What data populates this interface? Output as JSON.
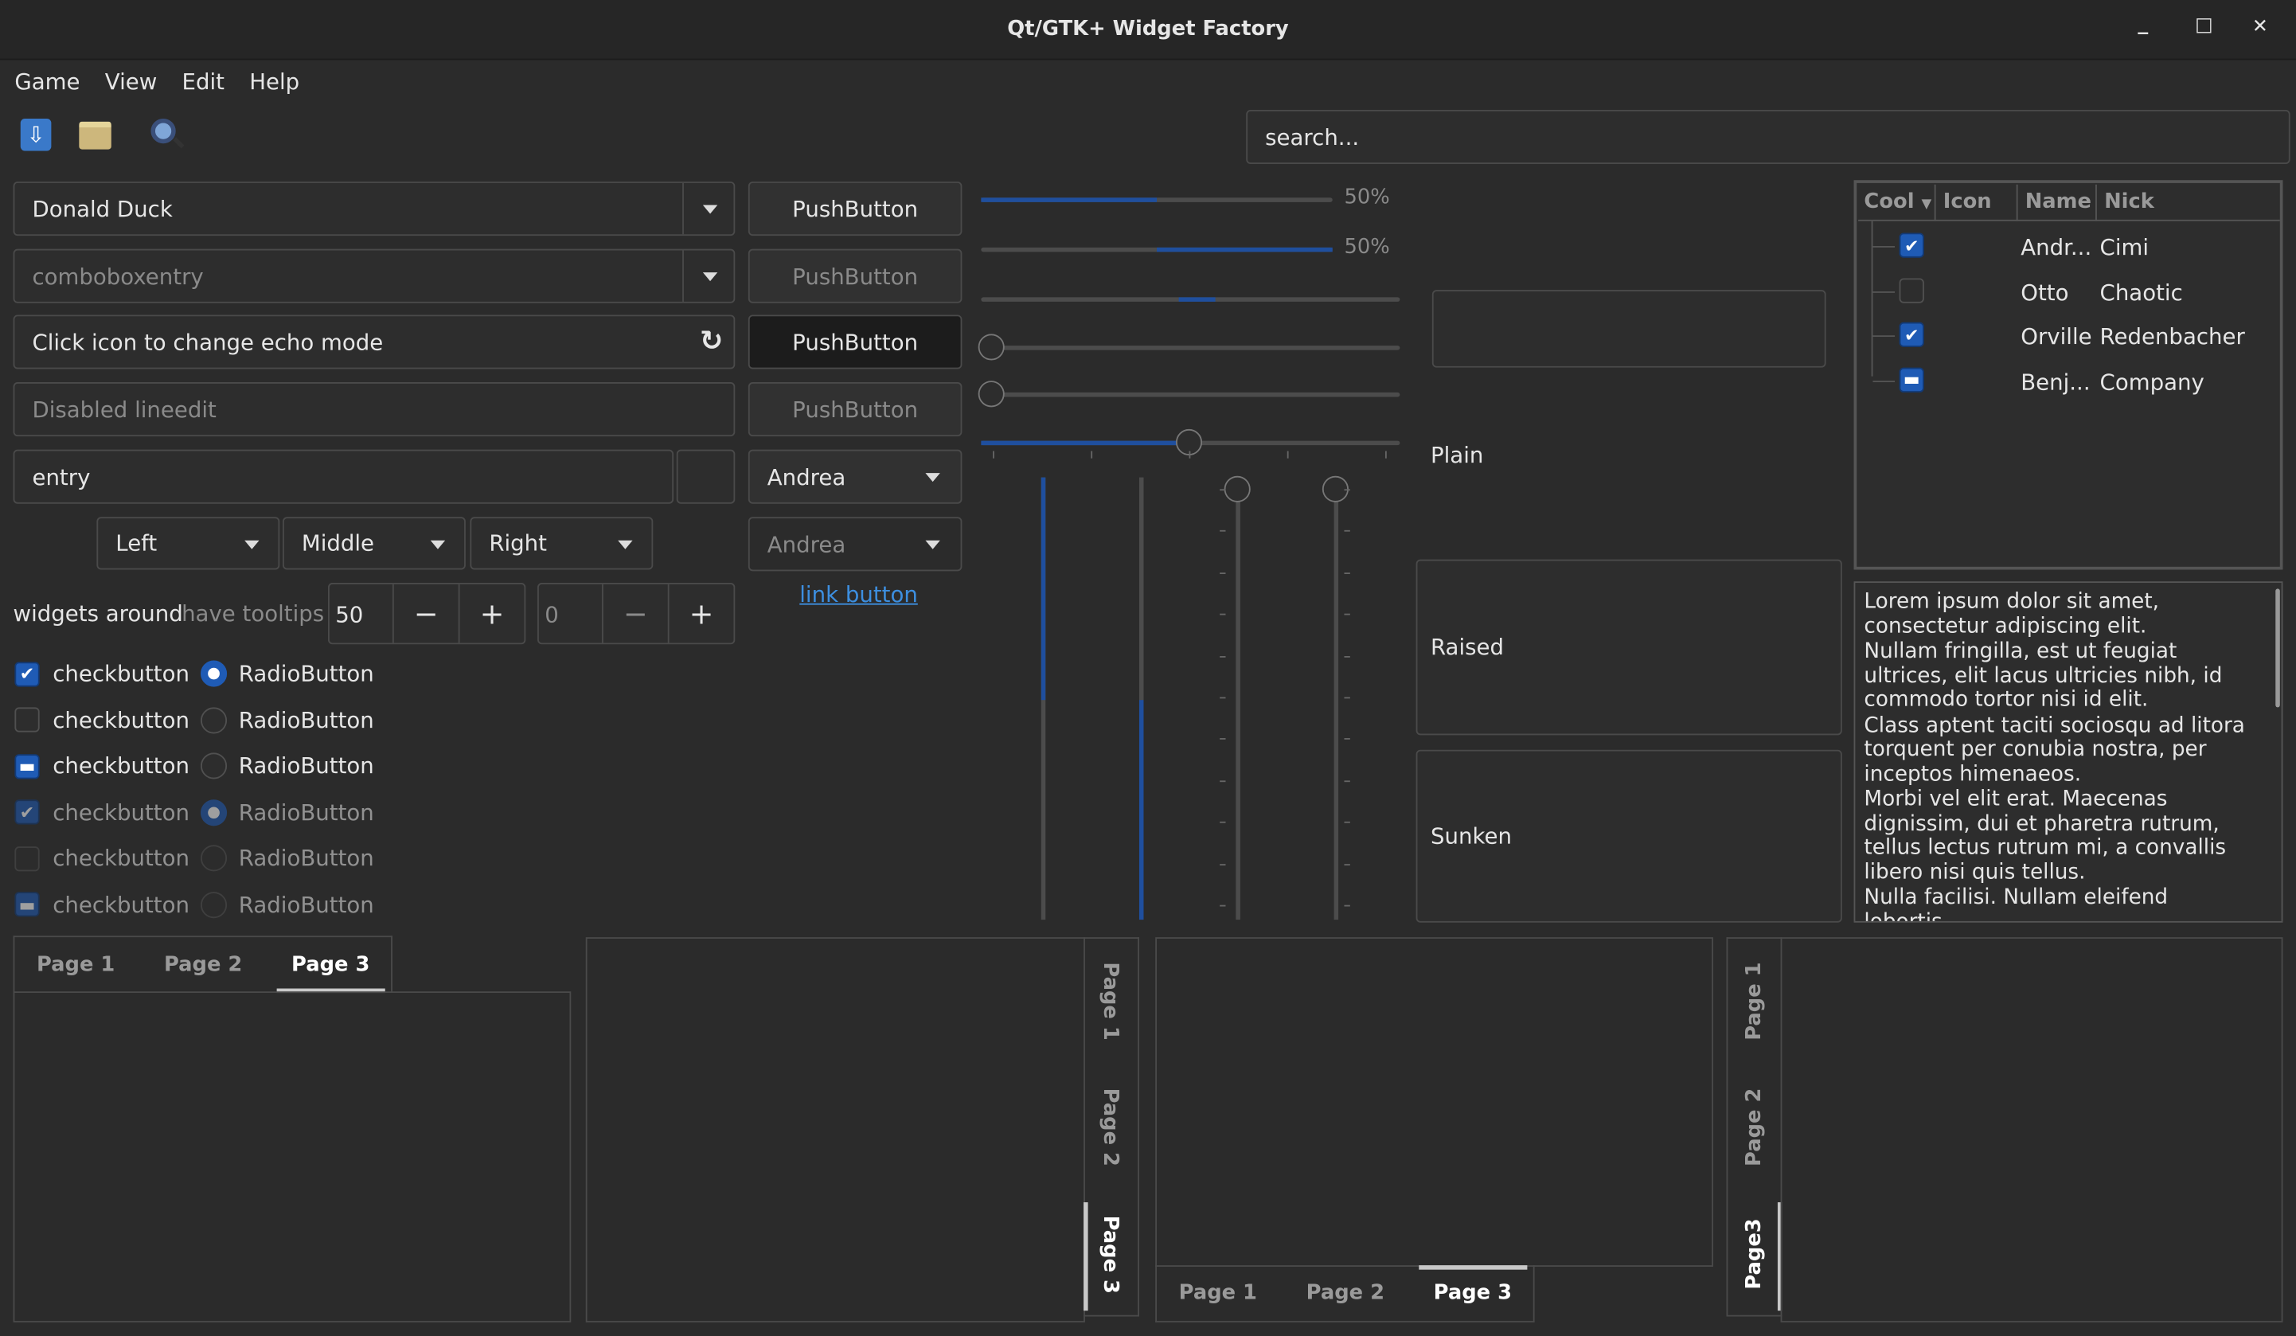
{
  "window": {
    "title": "Qt/GTK+ Widget Factory",
    "minimize": "_",
    "maximize": "□",
    "close": "✕"
  },
  "menu": [
    "Game",
    "View",
    "Edit",
    "Help"
  ],
  "toolbar": {
    "icons": [
      "save-icon",
      "open-folder-icon",
      "search-icon"
    ],
    "search_placeholder": "search..."
  },
  "left": {
    "combo1": "Donald Duck",
    "combo2_placeholder": "comboboxentry",
    "echo_entry": "Click icon to change echo mode",
    "disabled_entry": "Disabled lineedit",
    "entry": "entry",
    "align_combos": [
      "Left",
      "Middle",
      "Right"
    ],
    "tooltip_label1": "widgets around",
    "tooltip_label2": "have tooltips",
    "spin1": "50",
    "spin2": "0",
    "minus": "−",
    "plus": "+",
    "checks": [
      {
        "label": "checkbutton",
        "state": "checked",
        "enabled": true
      },
      {
        "label": "checkbutton",
        "state": "unchecked",
        "enabled": true
      },
      {
        "label": "checkbutton",
        "state": "mixed",
        "enabled": true
      },
      {
        "label": "checkbutton",
        "state": "checked",
        "enabled": false
      },
      {
        "label": "checkbutton",
        "state": "unchecked",
        "enabled": false
      },
      {
        "label": "checkbutton",
        "state": "mixed",
        "enabled": false
      }
    ],
    "radios": [
      {
        "label": "RadioButton",
        "checked": true,
        "enabled": true
      },
      {
        "label": "RadioButton",
        "checked": false,
        "enabled": true
      },
      {
        "label": "RadioButton",
        "checked": false,
        "enabled": true
      },
      {
        "label": "RadioButton",
        "checked": true,
        "enabled": false
      },
      {
        "label": "RadioButton",
        "checked": false,
        "enabled": false
      },
      {
        "label": "RadioButton",
        "checked": false,
        "enabled": false
      }
    ]
  },
  "buttons": {
    "push": [
      "PushButton",
      "PushButton",
      "PushButton",
      "PushButton"
    ],
    "combo_andrea": "Andrea",
    "combo_andrea_disabled": "Andrea",
    "link": "link button"
  },
  "sliders": {
    "h1_value": "50%",
    "h2_value": "50%",
    "h1_fraction": 0.5,
    "h2_fraction": 0.5
  },
  "frames": {
    "plain": "Plain",
    "raised": "Raised",
    "sunken": "Sunken"
  },
  "tree": {
    "columns": [
      "Cool",
      "Icon",
      "Name",
      "Nick"
    ],
    "rows": [
      {
        "cool": "checked",
        "name": "Andr...",
        "nick": "Cimi"
      },
      {
        "cool": "unchecked",
        "name": "Otto",
        "nick": "Chaotic"
      },
      {
        "cool": "checked",
        "name": "Orville",
        "nick": "Redenbacher"
      },
      {
        "cool": "mixed",
        "name": "Benj...",
        "nick": "Company"
      }
    ]
  },
  "textview": [
    "Lorem ipsum dolor sit amet, consectetur adipiscing elit.",
    "Nullam fringilla, est ut feugiat ultrices, elit lacus ultricies nibh, id commodo tortor nisi id elit.",
    "Class aptent taciti sociosqu ad litora torquent per conubia nostra, per inceptos himenaeos.",
    "Morbi vel elit erat. Maecenas dignissim, dui et pharetra rutrum, tellus lectus rutrum mi, a convallis libero nisi quis tellus.",
    "Nulla facilisi. Nullam eleifend lobortis"
  ],
  "notebooks": {
    "top": [
      "Page 1",
      "Page 2",
      "Page 3"
    ],
    "right": [
      "Page 1",
      "Page 2",
      "Page 3"
    ],
    "bottom": [
      "Page 1",
      "Page 2",
      "Page 3"
    ],
    "left": [
      "Page 1",
      "Page 2",
      "Page3"
    ]
  }
}
